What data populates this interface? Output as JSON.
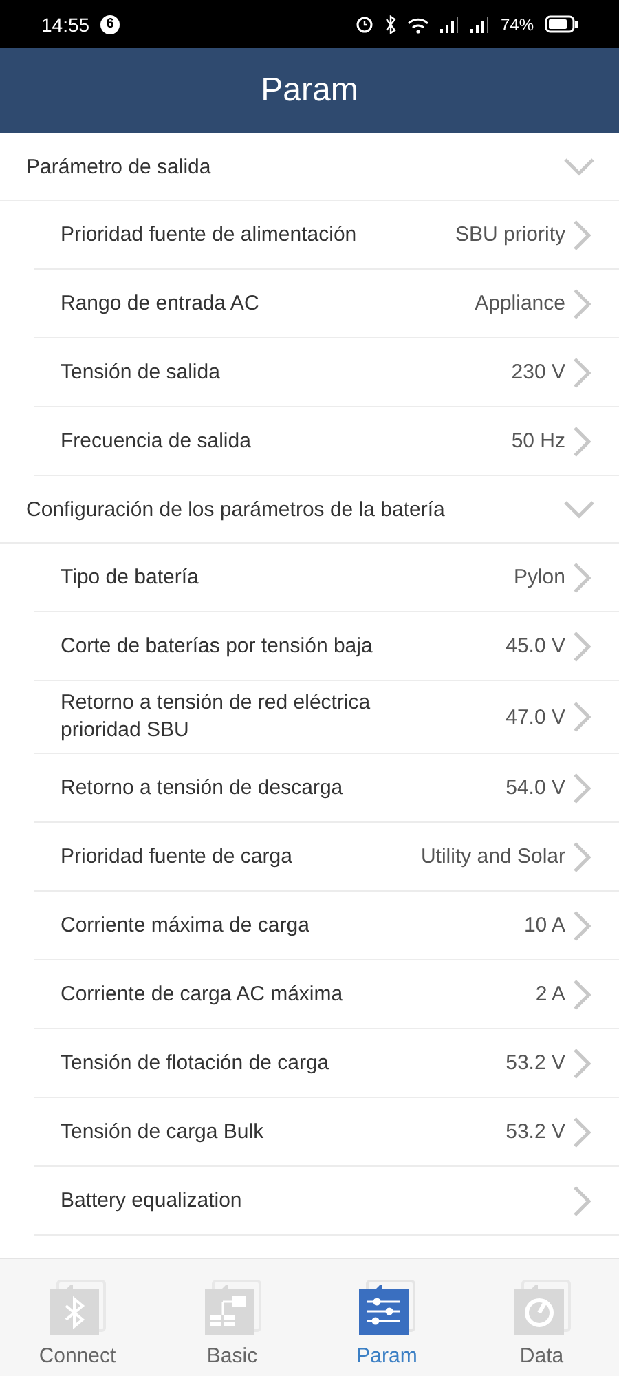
{
  "status_bar": {
    "time": "14:55",
    "notification_count": "6",
    "battery": "74%"
  },
  "header": {
    "title": "Param"
  },
  "sections": [
    {
      "title": "Parámetro de salida",
      "expanded": true,
      "items": [
        {
          "label": "Prioridad fuente de alimentación",
          "value": "SBU priority"
        },
        {
          "label": "Rango de entrada AC",
          "value": "Appliance"
        },
        {
          "label": "Tensión de salida",
          "value": "230 V"
        },
        {
          "label": "Frecuencia de salida",
          "value": "50 Hz"
        }
      ]
    },
    {
      "title": "Configuración de los parámetros de la batería",
      "expanded": true,
      "items": [
        {
          "label": "Tipo de batería",
          "value": "Pylon"
        },
        {
          "label": "Corte de baterías por tensión baja",
          "value": "45.0 V"
        },
        {
          "label": "Retorno a tensión de red eléctrica prioridad SBU",
          "value": "47.0 V"
        },
        {
          "label": "Retorno a tensión de descarga",
          "value": "54.0 V"
        },
        {
          "label": "Prioridad fuente de carga",
          "value": "Utility and Solar"
        },
        {
          "label": "Corriente máxima de carga",
          "value": "10 A"
        },
        {
          "label": "Corriente de carga AC máxima",
          "value": "2 A"
        },
        {
          "label": "Tensión de flotación de carga",
          "value": "53.2 V"
        },
        {
          "label": "Tensión de carga Bulk",
          "value": "53.2 V"
        },
        {
          "label": "Battery equalization"
        }
      ]
    }
  ],
  "tabs": [
    {
      "label": "Connect",
      "kind": "bluetooth",
      "selected": false
    },
    {
      "label": "Basic",
      "kind": "diagram",
      "selected": false
    },
    {
      "label": "Param",
      "kind": "sliders",
      "selected": true
    },
    {
      "label": "Data",
      "kind": "gauge",
      "selected": false
    }
  ]
}
